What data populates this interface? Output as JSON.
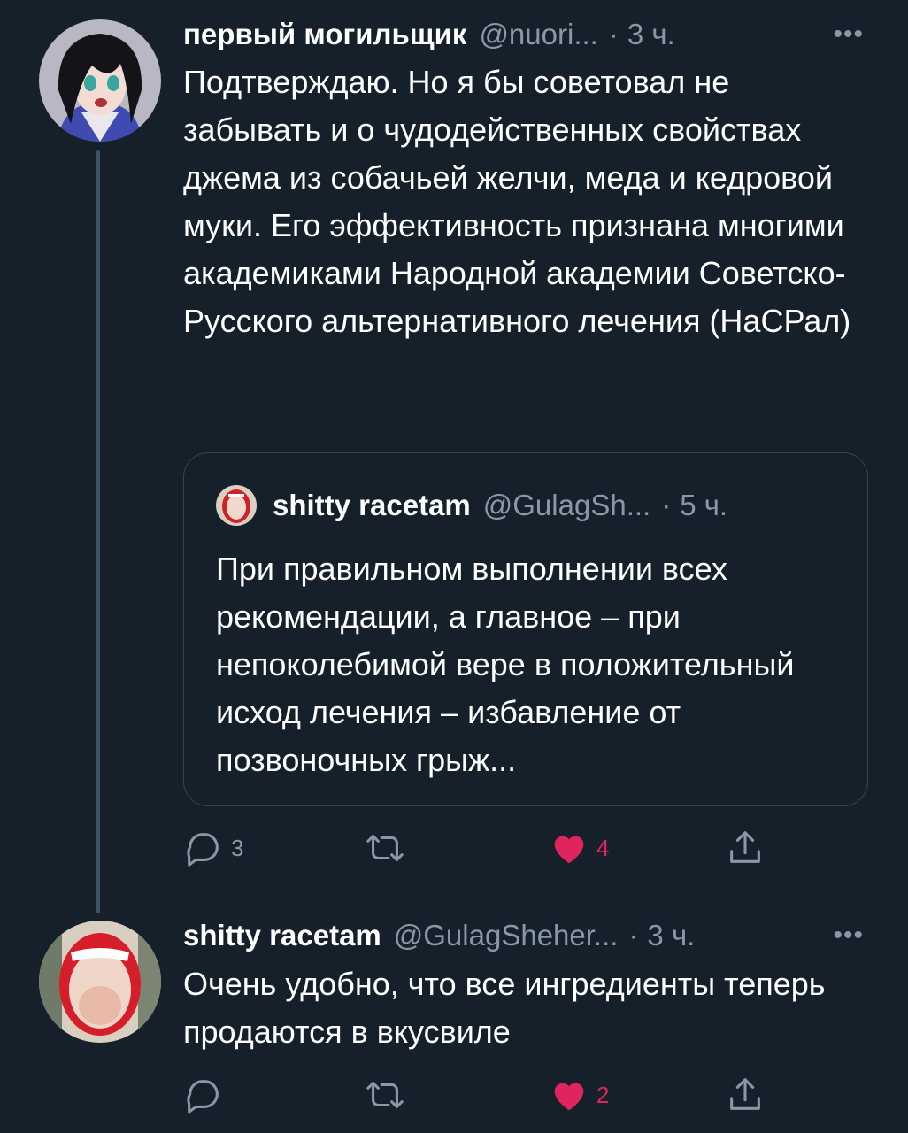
{
  "tweet1": {
    "name": "первый могильщик",
    "handle": "@nuori...",
    "separator": "·",
    "time": "3 ч.",
    "more": "•••",
    "text": "Подтверждаю. Но я бы советовал не забывать и о чудодейственных свойствах джема из собачьей желчи, меда и кедровой муки. Его эффективность признана многими академиками Народной академии Советско-Русского альтернативного лечения (НаСРал)",
    "quote": {
      "name": "shitty racetam",
      "handle": "@GulagSh...",
      "separator": "·",
      "time": "5 ч.",
      "text": "При правильном выполнении всех рекомендации, а главное – при непоколебимой вере в положительный исход лечения – избавление от позвоночных грыж..."
    },
    "actions": {
      "replies": "3",
      "retweets": "",
      "likes": "4",
      "liked": true
    }
  },
  "tweet2": {
    "name": "shitty racetam",
    "handle": "@GulagSheher...",
    "separator": "·",
    "time": "3 ч.",
    "more": "•••",
    "text": "Очень удобно, что все ингредиенты теперь продаются в вкусвиле",
    "actions": {
      "replies": "",
      "retweets": "",
      "likes": "2",
      "liked": true
    }
  },
  "colors": {
    "background": "#15202b",
    "secondary_text": "#8899a6",
    "like_red": "#e0245e",
    "border": "#38444d",
    "thread_line": "#3d5466"
  },
  "icons": [
    "reply-icon",
    "retweet-icon",
    "like-heart-icon",
    "share-icon",
    "more-icon"
  ]
}
